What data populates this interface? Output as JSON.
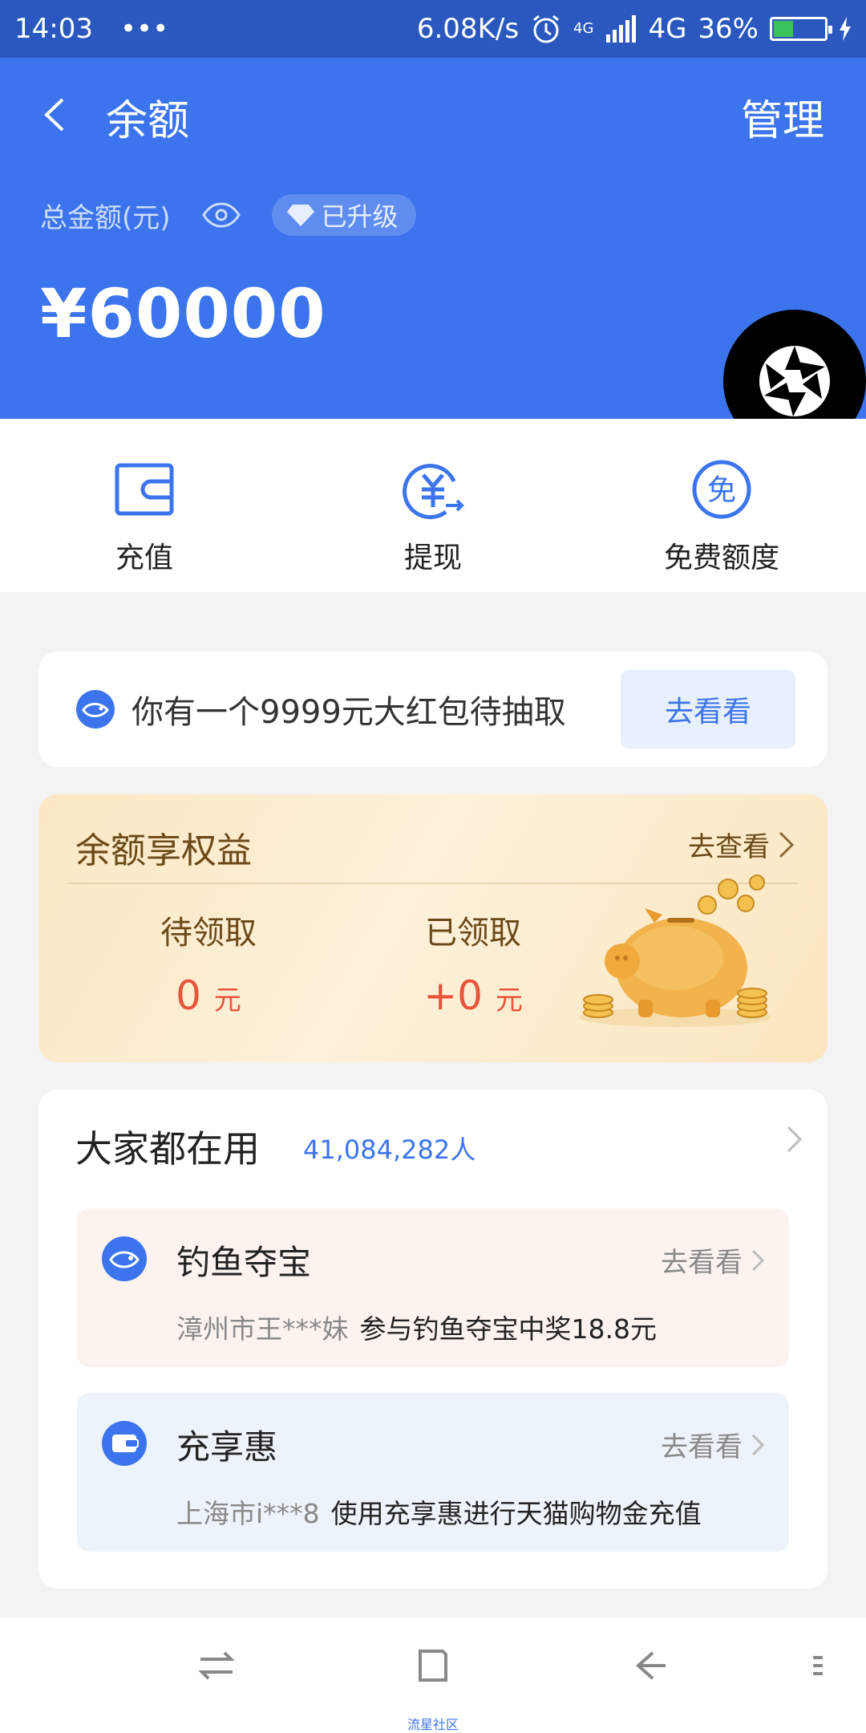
{
  "status_bar": {
    "time": "14:03",
    "dots": "•••",
    "speed": "6.08K/s",
    "network_small": "4G",
    "network": "4G",
    "battery": "36%",
    "battery_level": 0.36
  },
  "header": {
    "title": "余额",
    "manage": "管理",
    "total_label": "总金额(元)",
    "upgraded_label": "已升级",
    "amount": "¥60000"
  },
  "actions": [
    {
      "label": "充值",
      "icon": "wallet-icon"
    },
    {
      "label": "提现",
      "icon": "yuan-transfer-icon"
    },
    {
      "label": "免费额度",
      "icon": "free-icon"
    }
  ],
  "promo": {
    "text": "你有一个9999元大红包待抽取",
    "button": "去看看"
  },
  "benefit": {
    "title": "余额享权益",
    "link": "去查看",
    "pending_label": "待领取",
    "pending_value": "0",
    "pending_unit": "元",
    "received_label": "已领取",
    "received_value": "+0",
    "received_unit": "元"
  },
  "popular": {
    "title": "大家都在用",
    "count": "41,084,282人",
    "items": [
      {
        "name": "钓鱼夺宝",
        "go": "去看看",
        "who": "漳州市王***妹",
        "desc": "参与钓鱼夺宝中奖18.8元"
      },
      {
        "name": "充享惠",
        "go": "去看看",
        "who": "上海市i***8",
        "desc": "使用充享惠进行天猫购物金充值"
      }
    ]
  },
  "watermark": "流星社区",
  "colors": {
    "brand_blue": "#3b74ec",
    "status_blue": "#2a58bf",
    "red": "#e8543a"
  }
}
